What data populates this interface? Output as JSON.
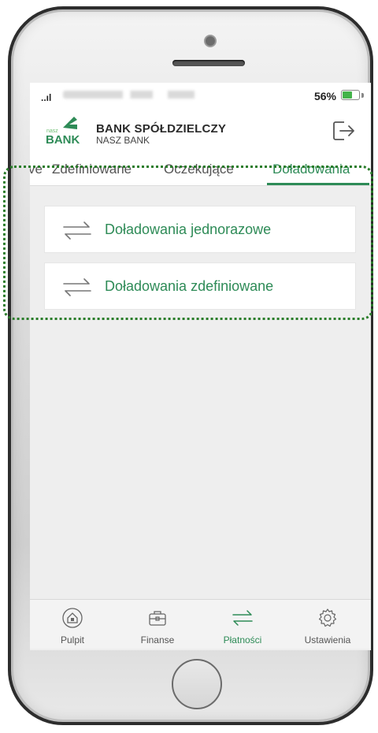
{
  "status_bar": {
    "signal": "..ıl",
    "battery_percent": "56%",
    "battery_level": 0.56
  },
  "header": {
    "bank_name": "BANK SPÓŁDZIELCZY",
    "bank_subtitle": "NASZ BANK",
    "logo_text": "BANK",
    "logo_small": "nasz",
    "brand_color": "#2e8b57"
  },
  "tabs": [
    {
      "label": "ve",
      "active": false
    },
    {
      "label": "Zdefiniowane",
      "active": false
    },
    {
      "label": "Oczekujące",
      "active": false
    },
    {
      "label": "Doładowania",
      "active": true
    }
  ],
  "list": [
    {
      "label": "Doładowania jednorazowe",
      "icon": "transfer-arrows-icon"
    },
    {
      "label": "Doładowania zdefiniowane",
      "icon": "transfer-arrows-icon"
    }
  ],
  "bottom_nav": [
    {
      "label": "Pulpit",
      "icon": "home-icon",
      "active": false
    },
    {
      "label": "Finanse",
      "icon": "briefcase-icon",
      "active": false
    },
    {
      "label": "Płatności",
      "icon": "transfer-arrows-icon",
      "active": true
    },
    {
      "label": "Ustawienia",
      "icon": "gear-icon",
      "active": false
    }
  ]
}
